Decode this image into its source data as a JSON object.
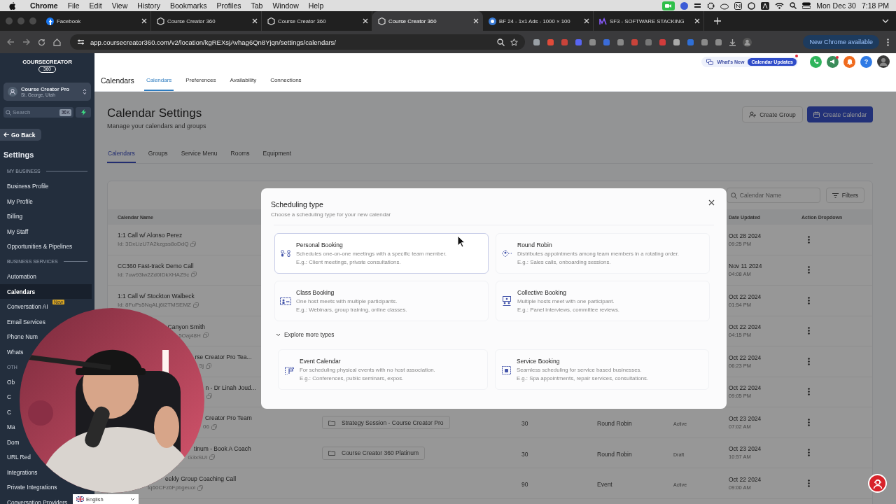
{
  "menubar": {
    "app": "Chrome",
    "menus": [
      "File",
      "Edit",
      "View",
      "History",
      "Bookmarks",
      "Profiles",
      "Tab",
      "Window",
      "Help"
    ],
    "date": "Mon Dec 30",
    "time": "7:18 PM"
  },
  "browser": {
    "tabs": [
      {
        "title": "Facebook",
        "selected": false
      },
      {
        "title": "Course Creator 360",
        "selected": false
      },
      {
        "title": "Course Creator 360",
        "selected": false
      },
      {
        "title": "Course Creator 360",
        "selected": true
      },
      {
        "title": "BF 24 - 1x1 Ads - 1000 × 100",
        "selected": false
      },
      {
        "title": "SF3 - SOFTWARE STACKING",
        "selected": false
      }
    ],
    "url": "app.coursecreator360.com/v2/location/kgREXsjAvhag6Qn8Yjqn/settings/calendars/",
    "update": "New Chrome available"
  },
  "sidebar": {
    "logo": {
      "wordmark": "COURSECREATOR",
      "badge": "360"
    },
    "account": {
      "name": "Course Creator Pro",
      "location": "St. George, Utah"
    },
    "search": {
      "placeholder": "Search",
      "shortcut": "⌘K"
    },
    "back": "Go Back",
    "title": "Settings",
    "groups": [
      {
        "heading": "MY BUSINESS",
        "items": [
          {
            "label": "Business Profile",
            "selected": false
          },
          {
            "label": "My Profile",
            "selected": false
          },
          {
            "label": "Billing",
            "selected": false
          },
          {
            "label": "My Staff",
            "selected": false
          },
          {
            "label": "Opportunities & Pipelines",
            "selected": false
          }
        ]
      },
      {
        "heading": "BUSINESS SERVICES",
        "items": [
          {
            "label": "Automation",
            "selected": false
          },
          {
            "label": "Calendars",
            "selected": true
          },
          {
            "label": "Conversation AI",
            "selected": false,
            "badge": "New"
          },
          {
            "label": "Email Services",
            "selected": false
          },
          {
            "label": "Phone Num",
            "selected": false
          },
          {
            "label": "Whats",
            "selected": false
          }
        ]
      },
      {
        "heading": "OTH",
        "items": [
          {
            "label": "Ob",
            "selected": false
          },
          {
            "label": "C",
            "selected": false
          },
          {
            "label": "C",
            "selected": false
          },
          {
            "label": "Ma",
            "selected": false
          },
          {
            "label": "Dom",
            "selected": false
          },
          {
            "label": "URL Red",
            "selected": false
          },
          {
            "label": "Integrations",
            "selected": false
          },
          {
            "label": "Private Integrations",
            "selected": false
          },
          {
            "label": "Conversation Providers",
            "selected": false
          }
        ]
      }
    ]
  },
  "language": "English",
  "header": {
    "title": "Calendars",
    "tabs": [
      {
        "label": "Calendars",
        "selected": true
      },
      {
        "label": "Preferences",
        "selected": false
      },
      {
        "label": "Availability",
        "selected": false
      },
      {
        "label": "Connections",
        "selected": false
      }
    ],
    "whats_new": "What's New",
    "updates": "Calendar Updates",
    "help": "?"
  },
  "page": {
    "title": "Calendar Settings",
    "subtitle": "Manage your calendars and groups",
    "buttons": [
      {
        "label": "Create Group",
        "kind": "secondary"
      },
      {
        "label": "Create Calendar",
        "kind": "primary"
      }
    ],
    "tabs": [
      {
        "label": "Calendars",
        "selected": true
      },
      {
        "label": "Groups",
        "selected": false
      },
      {
        "label": "Service Menu",
        "selected": false
      },
      {
        "label": "Rooms",
        "selected": false
      },
      {
        "label": "Equipment",
        "selected": false
      }
    ],
    "search": {
      "placeholder": "Calendar Name"
    },
    "filters": "Filters",
    "columns": {
      "name": "Calendar Name",
      "date": "Date Updated",
      "action": "Action Dropdown"
    },
    "rows": [
      {
        "name": "1:1 Call w/ Alonso Perez",
        "id": "Id: 3DxLizU7A2kzgss8oDdQ",
        "date": "Oct 28 2024",
        "time": "09:25 PM"
      },
      {
        "name": "CC360 Fast-track Demo Call",
        "id": "Id: 7uw93lw2Zd0IDkXHAZ9c",
        "date": "Nov 11 2024",
        "time": "04:08 AM"
      },
      {
        "name": "1:1 Call w/ Stockton Walbeck",
        "id": "Id: 8FuPs5NqALj6i2TMSEMZ",
        "date": "Oct 22 2024",
        "time": "01:54 PM"
      },
      {
        "name": "Canyon Smith",
        "id": "5Oaj48H",
        "date": "Oct 22 2024",
        "time": "04:15 PM"
      },
      {
        "name": "rse Creator Pro Tea...",
        "id": "5j",
        "date": "Oct 22 2024",
        "time": "06:23 PM"
      },
      {
        "name": "n - Dr Linah Joud...",
        "date": "Oct 22 2024",
        "time": "09:05 PM"
      },
      {
        "name": "Creator Pro Team",
        "id": "06",
        "group": "Strategy Session - Course Creator Pro",
        "duration": "30",
        "type": "Round Robin",
        "status": "Active",
        "date": "Oct 23 2024",
        "time": "07:02 AM"
      },
      {
        "name": "tinum - Book A Coach",
        "id": "G3xSUI",
        "group": "Course Creator 360 Platinum",
        "duration": "30",
        "type": "Round Robin",
        "status": "Draft",
        "date": "Oct 23 2024",
        "time": "10:57 AM"
      },
      {
        "name": "eekly Group Coaching Call",
        "id": "tq60CFz6Fpbgeuoi",
        "duration": "90",
        "type": "Event",
        "status": "Active",
        "date": "Oct 22 2024",
        "time": "09:00 AM"
      }
    ]
  },
  "modal": {
    "title": "Scheduling type",
    "subtitle": "Choose a scheduling type for your new calendar",
    "types": [
      {
        "name": "Personal Booking",
        "description": "Schedules one-on-one meetings with a specific team member.",
        "example": "E.g.: Client meetings, private consultations.",
        "selected": true
      },
      {
        "name": "Round Robin",
        "description": "Distributes appointments among team members in a rotating order.",
        "example": "E.g.: Sales calls, onboarding sessions.",
        "selected": false
      },
      {
        "name": "Class Booking",
        "description": "One host meets with multiple participants.",
        "example": "E.g.: Webinars, group training, online classes.",
        "selected": false
      },
      {
        "name": "Collective Booking",
        "description": "Multiple hosts meet with one participant.",
        "example": "E.g.: Panel interviews, committee reviews.",
        "selected": false
      }
    ],
    "more": {
      "label": "Explore more types",
      "expanded": true
    },
    "more_types": [
      {
        "name": "Event Calendar",
        "description": "For scheduling physical events with no host association.",
        "example": "E.g.: Conferences, public seminars, expos.",
        "selected": false
      },
      {
        "name": "Service Booking",
        "description": "Seamless scheduling for service based businesses.",
        "example": "E.g.: Spa appointments, repair services, consultations.",
        "selected": false
      }
    ]
  }
}
